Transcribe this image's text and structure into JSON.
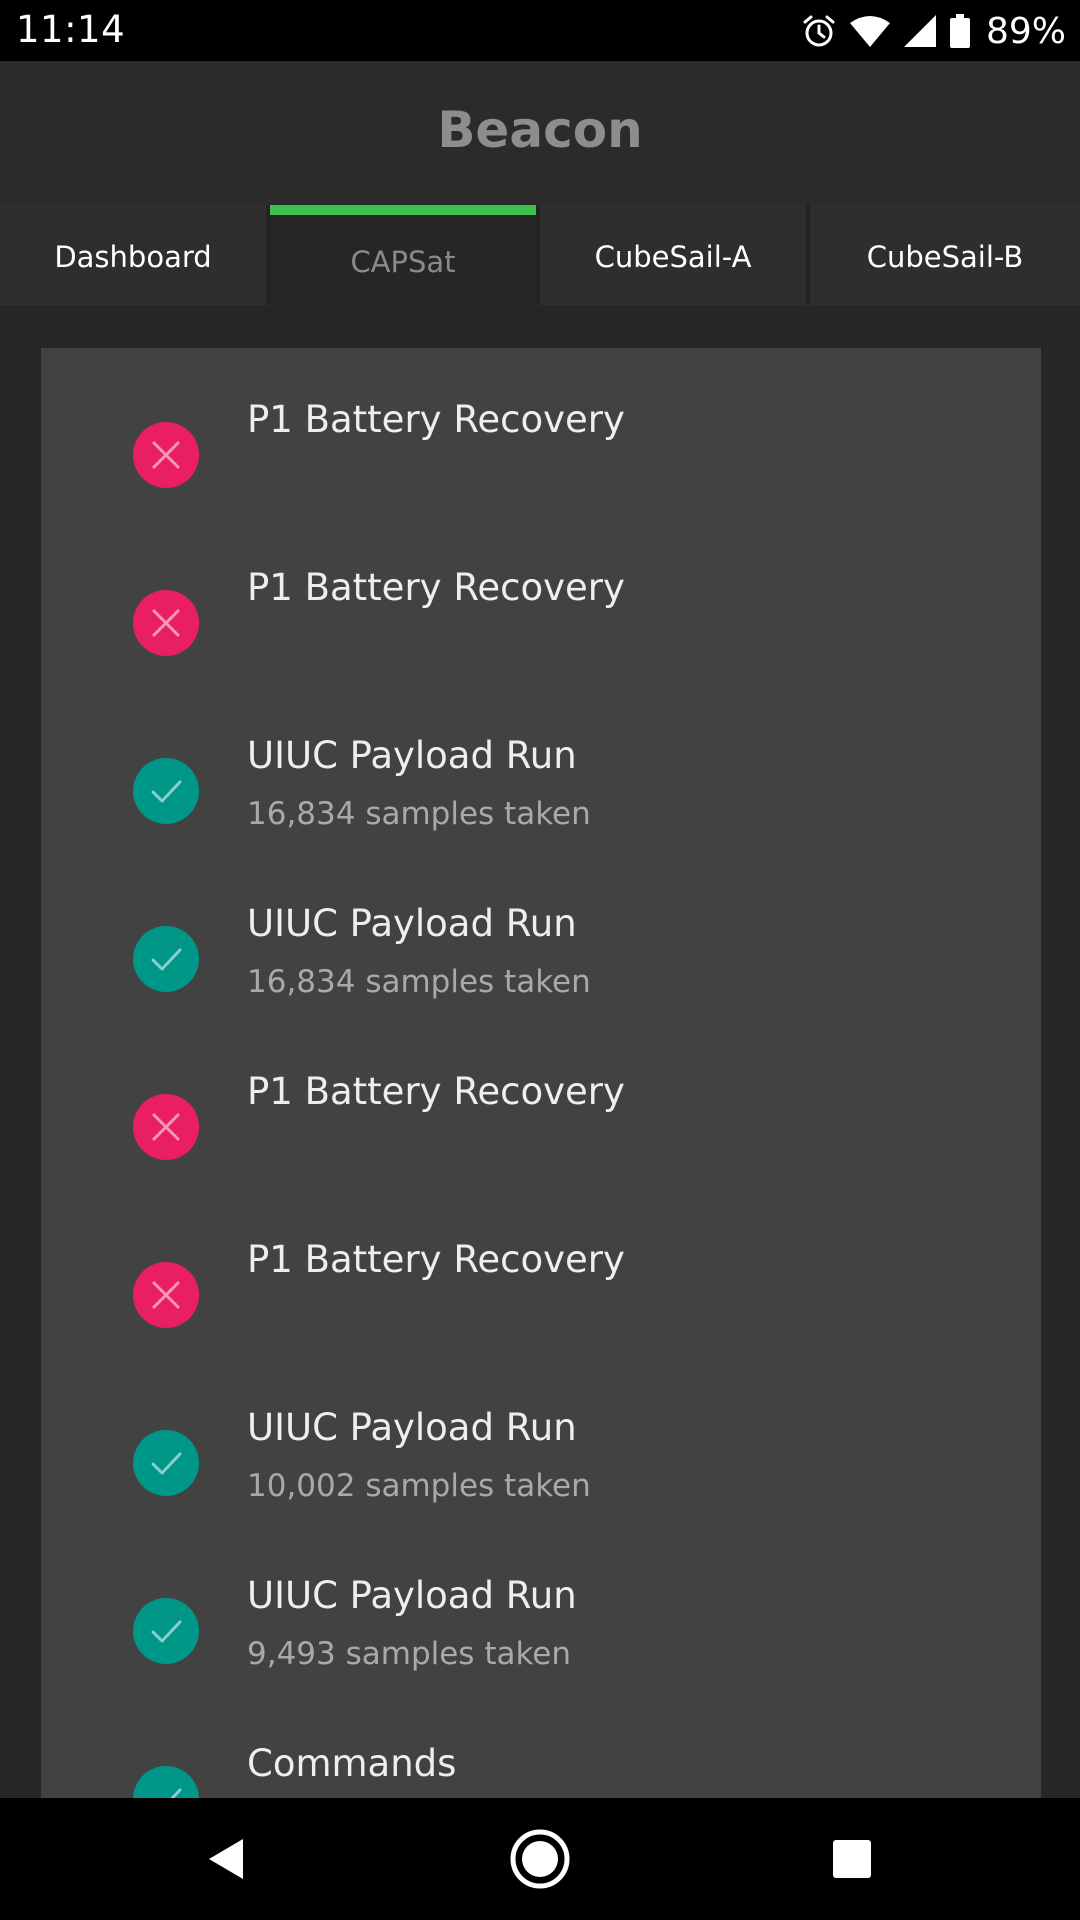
{
  "status_bar": {
    "time": "11:14",
    "battery_percent": "89%",
    "icons": [
      "alarm-icon",
      "wifi-icon",
      "cell-signal-icon",
      "battery-icon"
    ]
  },
  "app_bar": {
    "title": "Beacon"
  },
  "tabs": [
    {
      "label": "Dashboard",
      "active": false
    },
    {
      "label": "CAPSat",
      "active": true
    },
    {
      "label": "CubeSail-A",
      "active": false
    },
    {
      "label": "CubeSail-B",
      "active": false
    }
  ],
  "colors": {
    "tab_indicator": "#3ec14b",
    "fail": "#e91e63",
    "success": "#009688",
    "card_bg": "#424242"
  },
  "items": [
    {
      "title": "P1 Battery Recovery",
      "subtitle": "",
      "status": "fail",
      "icon": "close-icon"
    },
    {
      "title": "P1 Battery Recovery",
      "subtitle": "",
      "status": "fail",
      "icon": "close-icon"
    },
    {
      "title": "UIUC Payload Run",
      "subtitle": "16,834 samples taken",
      "status": "ok",
      "icon": "check-icon"
    },
    {
      "title": "UIUC Payload Run",
      "subtitle": "16,834 samples taken",
      "status": "ok",
      "icon": "check-icon"
    },
    {
      "title": "P1 Battery Recovery",
      "subtitle": "",
      "status": "fail",
      "icon": "close-icon"
    },
    {
      "title": "P1 Battery Recovery",
      "subtitle": "",
      "status": "fail",
      "icon": "close-icon"
    },
    {
      "title": "UIUC Payload Run",
      "subtitle": "10,002 samples taken",
      "status": "ok",
      "icon": "check-icon"
    },
    {
      "title": "UIUC Payload Run",
      "subtitle": "9,493 samples taken",
      "status": "ok",
      "icon": "check-icon"
    },
    {
      "title": "Commands",
      "subtitle": "",
      "status": "ok",
      "icon": "check-icon"
    }
  ],
  "nav_bar": {
    "buttons": [
      "back-icon",
      "home-icon",
      "recents-icon"
    ]
  }
}
